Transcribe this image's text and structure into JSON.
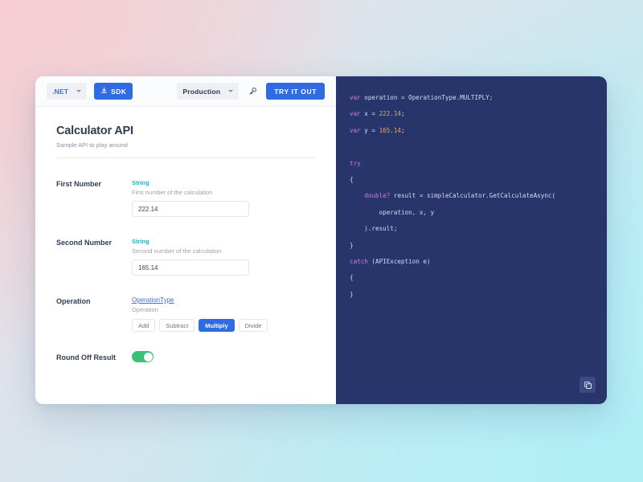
{
  "toolbar": {
    "language": ".NET",
    "sdk_label": "SDK",
    "environment": "Production",
    "try_label": "TRY IT OUT",
    "icons": {
      "download": "download-icon",
      "key": "key-icon",
      "chevron": "chevron-down-icon"
    }
  },
  "header": {
    "title": "Calculator API",
    "subtitle": "Sample API to play around"
  },
  "fields": [
    {
      "label": "First Number",
      "type": "String",
      "description": "First number of the calculation",
      "value": "222.14"
    },
    {
      "label": "Second Number",
      "type": "String",
      "description": "Second number of the calculation",
      "value": "165.14"
    }
  ],
  "operation": {
    "label": "Operation",
    "type": "OperationType",
    "description": "Operation",
    "options": [
      "Add",
      "Subtract",
      "Multiply",
      "Divide"
    ],
    "selected": "Multiply"
  },
  "round_off": {
    "label": "Round Off Result",
    "enabled": true
  },
  "code_panel": {
    "copy_icon": "copy-icon",
    "lines": [
      "var operation = OperationType.MULTIPLY;",
      "var x = 222.14;",
      "var y = 165.14;",
      "",
      "try",
      "{",
      "    double? result = simpleCalculator.GetCalculateAsync(",
      "        operation, x, y",
      "    ).result;",
      "}",
      "catch (APIException e)",
      "{",
      "}"
    ]
  },
  "colors": {
    "accent_blue": "#2f6be3",
    "type_teal": "#18b5c4",
    "toggle_green": "#3ac07b",
    "code_bg": "#27356b",
    "code_keyword": "#d77ae0",
    "code_number": "#f0a35e",
    "title": "#2e3d55"
  }
}
